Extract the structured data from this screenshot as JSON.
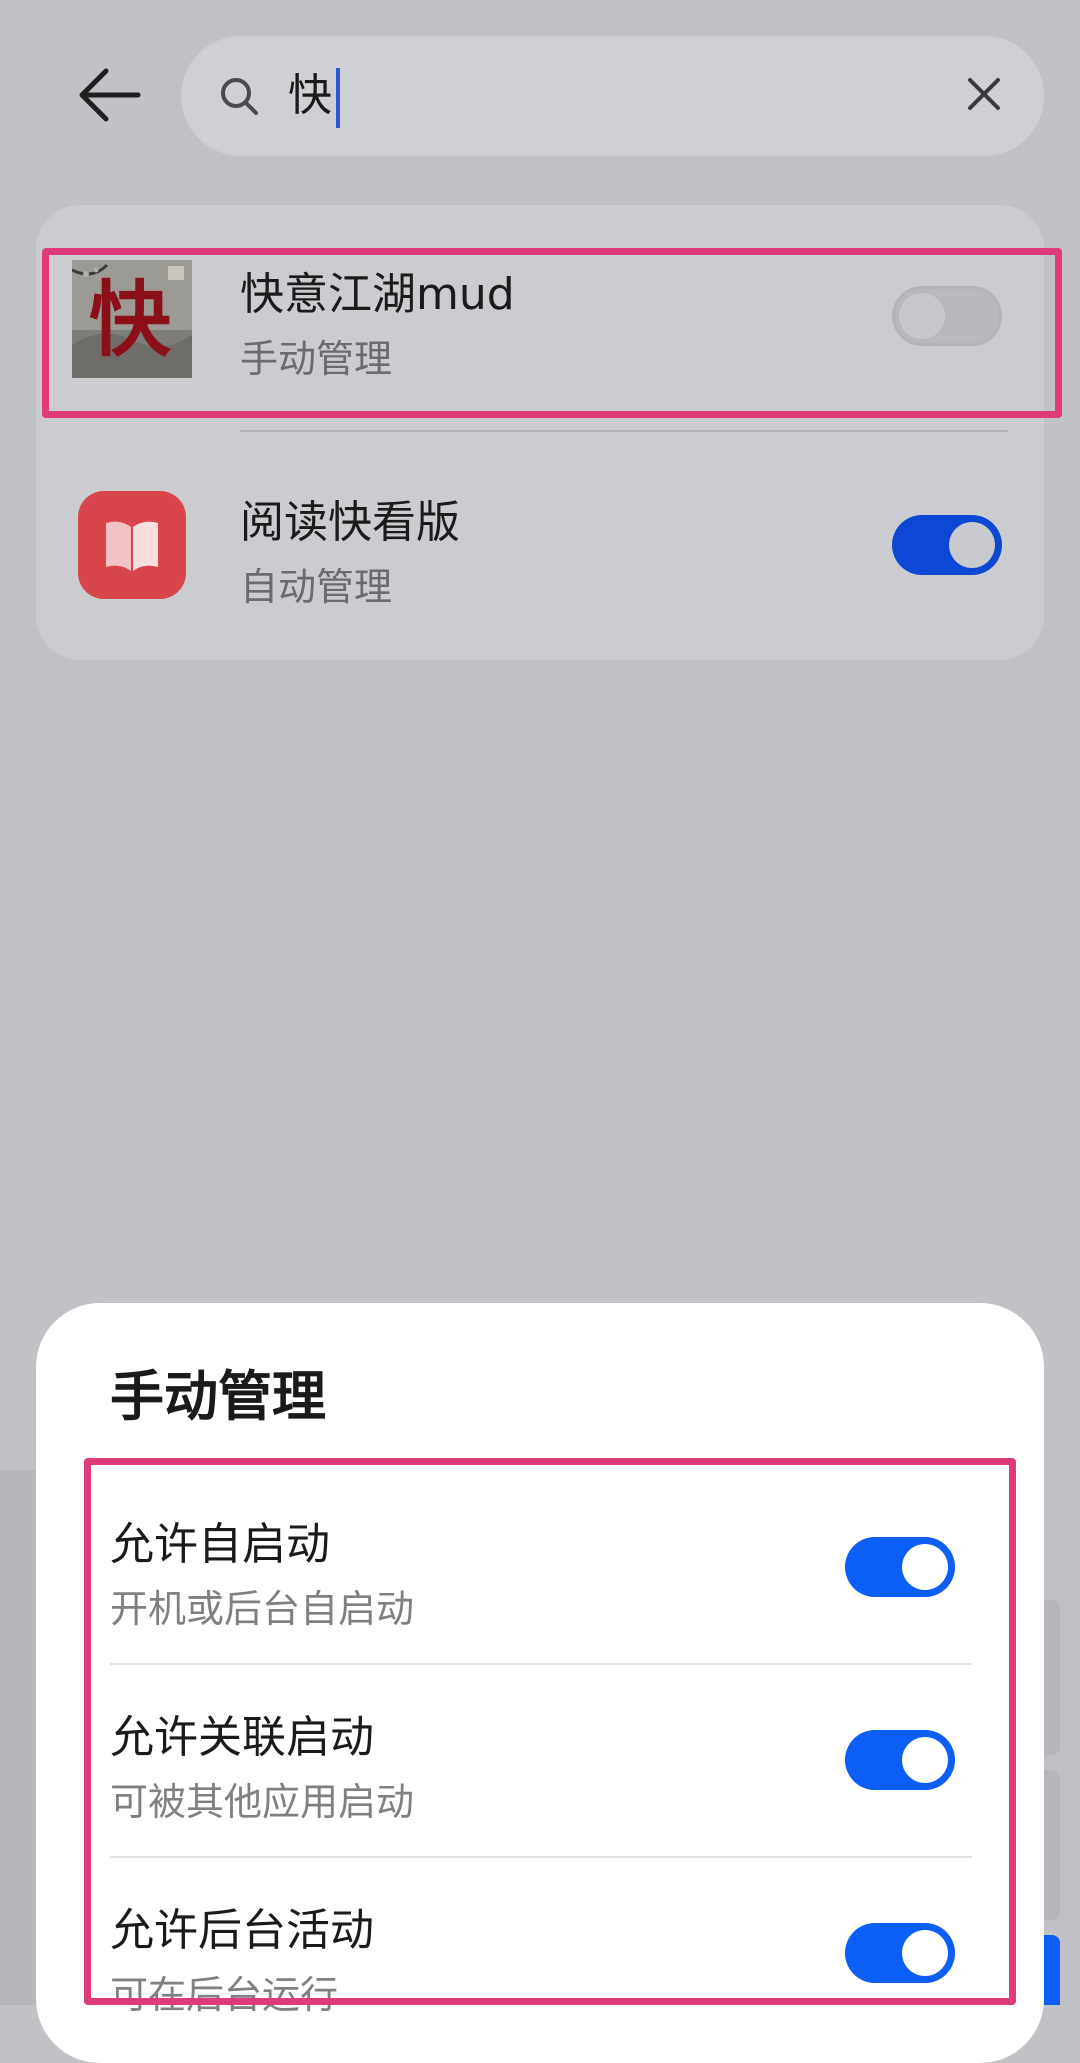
{
  "search": {
    "query": "快"
  },
  "results": [
    {
      "name": "快意江湖mud",
      "status": "手动管理",
      "toggle_on": false
    },
    {
      "name": "阅读快看版",
      "status": "自动管理",
      "toggle_on": true
    }
  ],
  "sheet": {
    "title": "手动管理",
    "settings": [
      {
        "title": "允许自启动",
        "desc": "开机或后台自启动",
        "on": true
      },
      {
        "title": "允许关联启动",
        "desc": "可被其他应用启动",
        "on": true
      },
      {
        "title": "允许后台活动",
        "desc": "可在后台运行",
        "on": true
      }
    ]
  },
  "colors": {
    "accent": "#0b5ef6",
    "highlight": "#df3b7a",
    "app_read_icon": "#d8454a"
  },
  "icons": {
    "back": "back-arrow-icon",
    "search": "search-icon",
    "clear": "close-icon",
    "game_app": "kuaiyi-jianghu-app-icon",
    "read_app": "book-app-icon"
  }
}
